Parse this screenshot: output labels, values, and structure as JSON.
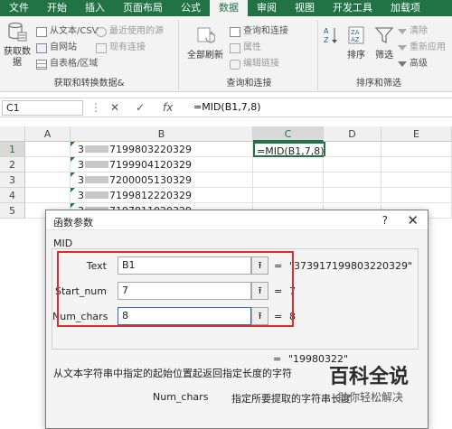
{
  "ribbon_tabs": [
    "文件",
    "开始",
    "插入",
    "页面布局",
    "公式",
    "数据",
    "审阅",
    "视图",
    "开发工具",
    "加载项"
  ],
  "active_tab": "数据",
  "get_data_group": {
    "big_button": "获取数\n据",
    "from_csv": "从文本/CSV",
    "from_web": "自网站",
    "from_table": "自表格/区域",
    "recent_sources": "最近使用的源",
    "existing_connections": "现有连接",
    "label": "获取和转换数据&"
  },
  "queries_group": {
    "refresh_all": "全部刷新",
    "queries_connections": "查询和连接",
    "properties": "属性",
    "edit_links": "编辑链接",
    "label": "查询和连接"
  },
  "sort_filter_group": {
    "sort": "排序",
    "filter": "筛选",
    "clear": "清除",
    "reapply": "重新应用",
    "advanced": "高级",
    "label": "排序和筛选"
  },
  "formula_bar": {
    "name_box": "C1",
    "cancel": "✕",
    "enter": "✓",
    "fx": "fx",
    "formula": "=MID(B1,7,8)"
  },
  "columns": [
    "A",
    "B",
    "C",
    "D",
    "E"
  ],
  "rows": [
    "1",
    "2",
    "3",
    "4",
    "5"
  ],
  "b_column": [
    {
      "prefix": "3",
      "suffix": "7199803220329"
    },
    {
      "prefix": "3",
      "suffix": "7199904120329"
    },
    {
      "prefix": "3",
      "suffix": "7200005130329"
    },
    {
      "prefix": "3",
      "suffix": "7199812220329"
    },
    {
      "prefix": "3",
      "suffix": "7197811020329"
    }
  ],
  "c1_value": "=MID(B1,7,8)",
  "dialog": {
    "title": "函数参数",
    "help": "?",
    "close": "✕",
    "function_name": "MID",
    "args": [
      {
        "label": "Text",
        "value": "B1",
        "result": "\"373917199803220329\""
      },
      {
        "label": "Start_num",
        "value": "7",
        "result": "7"
      },
      {
        "label": "Num_chars",
        "value": "8",
        "result": "8"
      }
    ],
    "equals": "=",
    "overall_result": "\"19980322\"",
    "description": "从文本字符串中指定的起始位置起返回指定长度的字符",
    "param_name": "Num_chars",
    "param_description": "指定所要提取的字符串长度"
  },
  "watermark": {
    "title": "百科全说",
    "subtitle": "助你轻松解决"
  },
  "colors": {
    "excel_green": "#217346",
    "highlight_red": "#e12b2b"
  }
}
